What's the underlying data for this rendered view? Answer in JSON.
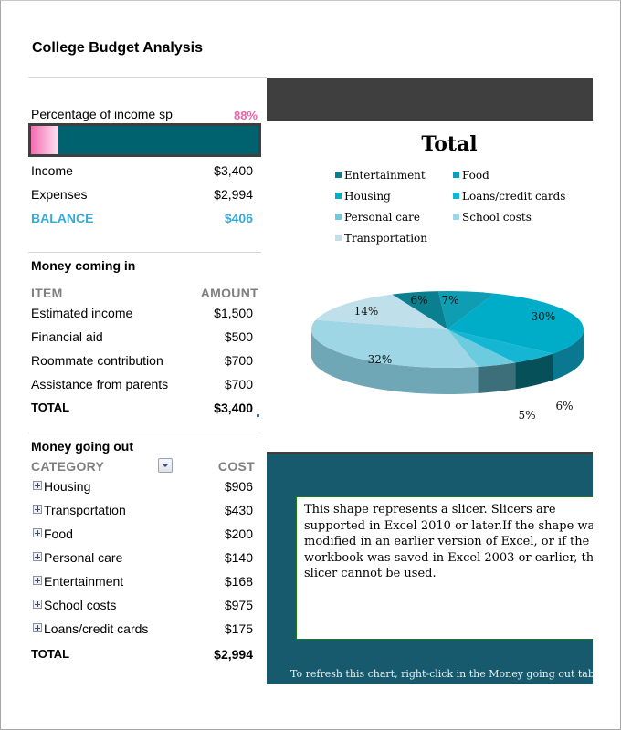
{
  "title": "College Budget Analysis",
  "summary": {
    "percent_label": "Percentage of income sp",
    "percent_value": "88%",
    "percent_spent": 0.88,
    "percent_color": "#f062a8",
    "bar_track_color": "#00626f",
    "rows": [
      {
        "label": "Income",
        "value": "$3,400"
      },
      {
        "label": "Expenses",
        "value": "$2,994"
      }
    ],
    "balance_label": "BALANCE",
    "balance_value": "$406",
    "balance_color": "#3aa9d8"
  },
  "income": {
    "heading": "Money coming in",
    "col_item": "ITEM",
    "col_amount": "AMOUNT",
    "rows": [
      {
        "label": "Estimated income",
        "value": "$1,500"
      },
      {
        "label": "Financial aid",
        "value": "$500"
      },
      {
        "label": "Roommate contribution",
        "value": "$700"
      },
      {
        "label": "Assistance from parents",
        "value": "$700"
      }
    ],
    "total_label": "TOTAL",
    "total_value": "$3,400"
  },
  "expenses": {
    "heading": "Money going out",
    "col_category": "CATEGORY",
    "col_cost": "COST",
    "filter_icon": "dropdown-filter-icon",
    "rows": [
      {
        "label": "Housing",
        "value": "$906"
      },
      {
        "label": "Transportation",
        "value": "$430"
      },
      {
        "label": "Food",
        "value": "$200"
      },
      {
        "label": "Personal care",
        "value": "$140"
      },
      {
        "label": "Entertainment",
        "value": "$168"
      },
      {
        "label": "School costs",
        "value": "$975"
      },
      {
        "label": "Loans/credit cards",
        "value": "$175"
      }
    ],
    "total_label": "TOTAL",
    "total_value": "$2,994"
  },
  "chart_data": {
    "type": "pie",
    "title": "Total",
    "legend_position": "top",
    "categories": [
      "Entertainment",
      "Food",
      "Housing",
      "Loans/credit cards",
      "Personal care",
      "School costs",
      "Transportation"
    ],
    "values": [
      168,
      200,
      906,
      175,
      140,
      975,
      430
    ],
    "labels": [
      "6%",
      "7%",
      "30%",
      "6%",
      "5%",
      "32%",
      "14%"
    ],
    "colors": [
      "#0a7f8f",
      "#0e9db3",
      "#00adc8",
      "#14b6d3",
      "#6ccbde",
      "#9fd6e6",
      "#bfe0ea"
    ],
    "side_colors": [
      "#06505b",
      "#076a78",
      "#0a7890",
      "#06505a",
      "#3d6f7a",
      "#6fa7b6",
      "#8cb8c4"
    ]
  },
  "slicer": {
    "message": "This shape represents a slicer. Slicers are supported in Excel 2010 or later.If the shape was modified in an earlier version of Excel, or if the workbook was saved in Excel 2003 or earlier, the slicer cannot be used.",
    "refresh_note": "To refresh this chart, right-click in the Money going out table"
  }
}
